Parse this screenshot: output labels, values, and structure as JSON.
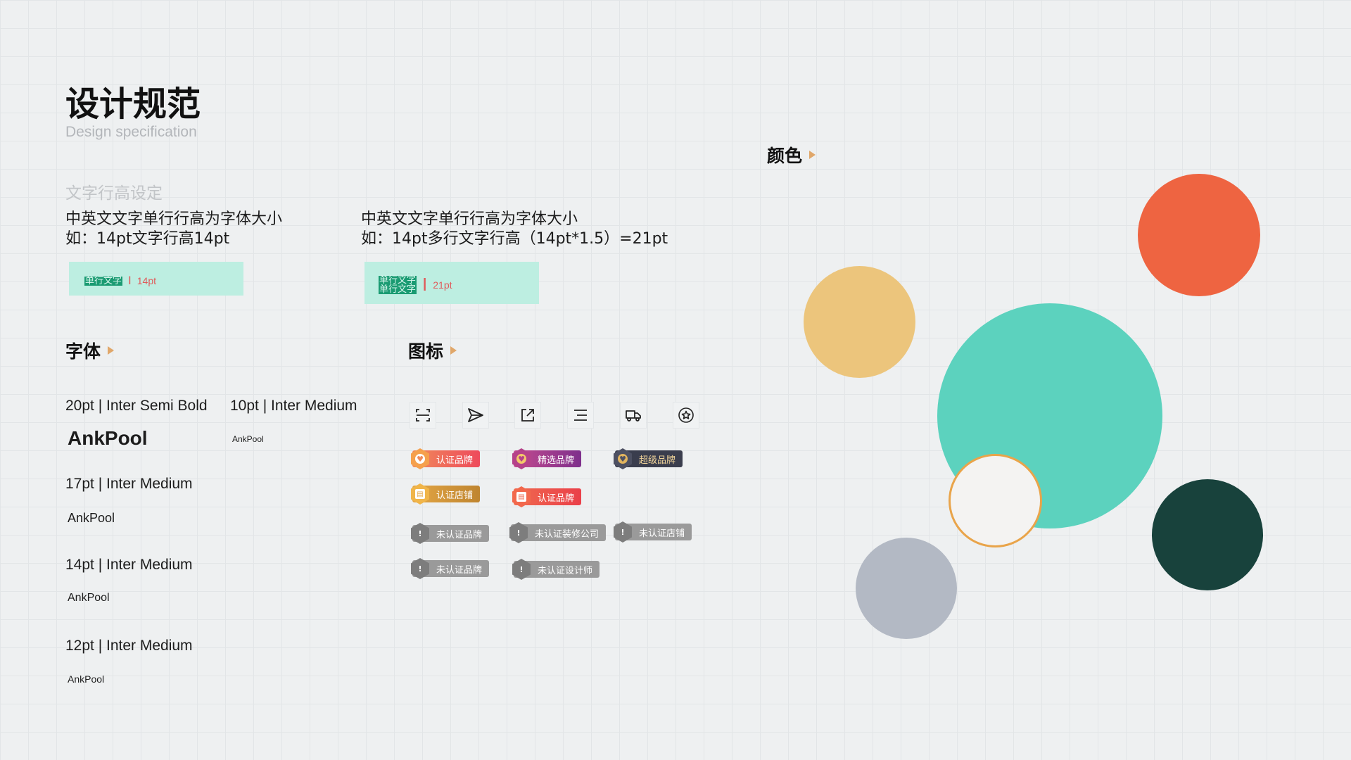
{
  "header": {
    "title": "设计规范",
    "subtitle": "Design specification"
  },
  "line_height": {
    "section_title": "文字行高设定",
    "single": {
      "desc_line1": "中英文文字单行行高为字体大小",
      "desc_line2": "如：14pt文字行高14pt",
      "sample_text": "单行文字",
      "value": "14pt"
    },
    "multi": {
      "desc_line1": "中英文文字单行行高为字体大小",
      "desc_line2": "如：14pt多行文字行高（14pt*1.5）=21pt",
      "sample_text_1": "单行文字",
      "sample_text_2": "单行文字",
      "value": "21pt"
    }
  },
  "fonts": {
    "heading": "字体",
    "items": [
      {
        "spec": "20pt | Inter Semi Bold",
        "sample": "AnkPool"
      },
      {
        "spec": "10pt | Inter Medium",
        "sample": "AnkPool"
      },
      {
        "spec": "17pt | Inter Medium",
        "sample": "AnkPool"
      },
      {
        "spec": "14pt | Inter Medium",
        "sample": "AnkPool"
      },
      {
        "spec": "12pt | Inter Medium",
        "sample": "AnkPool"
      }
    ]
  },
  "icons": {
    "heading": "图标",
    "toolbar": [
      "scan-icon",
      "send-icon",
      "external-link-icon",
      "menu-icon",
      "truck-icon",
      "star-circle-icon"
    ],
    "badges": {
      "certified_brand": "认证品牌",
      "selected_brand": "精选品牌",
      "super_brand": "超级品牌",
      "certified_store": "认证店铺",
      "certified_brand_2": "认证品牌",
      "uncertified_brand": "未认证品牌",
      "uncertified_decor_company": "未认证装修公司",
      "uncertified_store": "未认证店铺",
      "uncertified_brand_2": "未认证品牌",
      "uncertified_designer": "未认证设计师"
    }
  },
  "colors": {
    "heading": "颜色",
    "swatches": [
      "#ee6441",
      "#ecc57c",
      "#5cd2be",
      "#f4f3f2",
      "#e9a44a",
      "#18423c",
      "#b3b9c4"
    ]
  }
}
